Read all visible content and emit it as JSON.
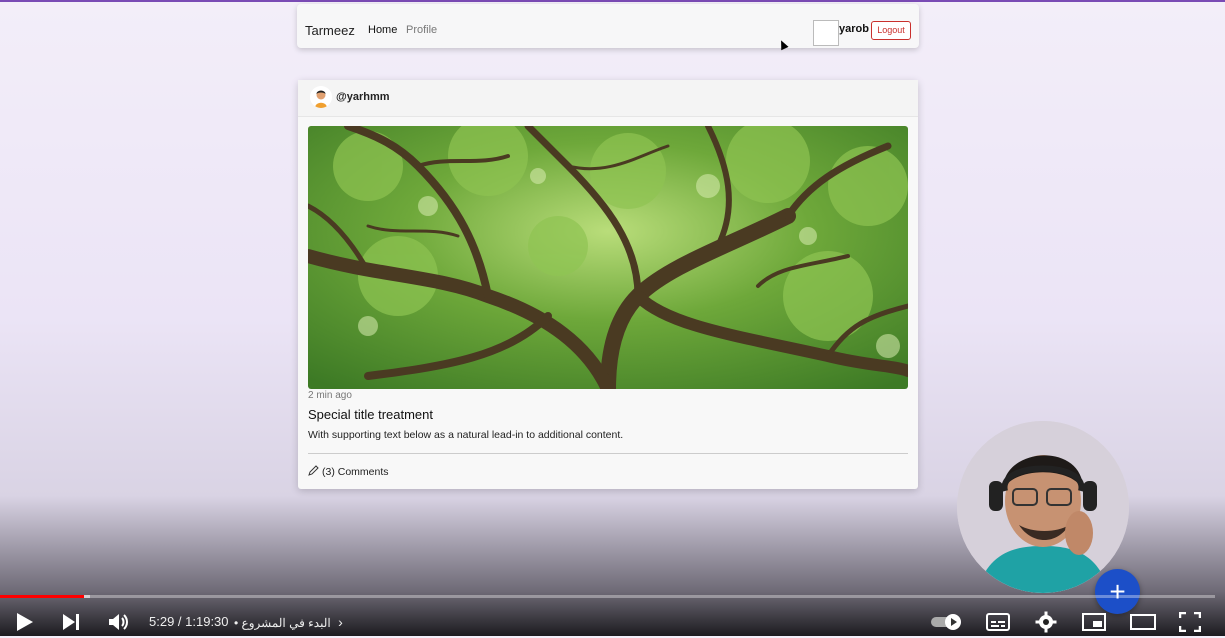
{
  "navbar": {
    "brand": "Tarmeez",
    "home_label": "Home",
    "profile_label": "Profile",
    "username": "yarob",
    "logout_label": "Logout"
  },
  "post": {
    "author": "@yarhmm",
    "time_ago": "2 min ago",
    "title": "Special title treatment",
    "body": "With supporting text below as a natural lead-in to additional content.",
    "comments_label": "(3) Comments"
  },
  "player": {
    "current_time": "5:29",
    "duration": "1:19:30",
    "time_display": "5:29 / 1:19:30",
    "chapter_title": "البدء في المشروع",
    "progress_fraction": 0.069,
    "buffered_fraction": 0.074,
    "autoplay": "on"
  },
  "fab": {
    "label": "+"
  },
  "colors": {
    "accent": "#7a4bb5",
    "logout": "#c9302c",
    "fab": "#1c4fc8",
    "progress": "#ff0000"
  }
}
